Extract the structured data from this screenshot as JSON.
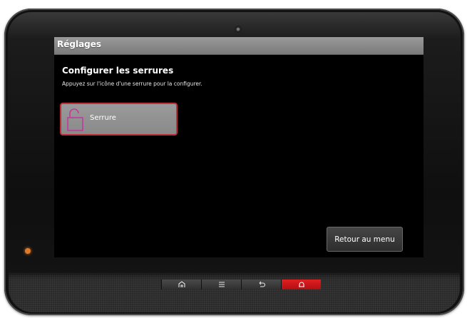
{
  "titlebar": {
    "title": "Réglages"
  },
  "main": {
    "heading": "Configurer les serrures",
    "subtitle": "Appuyez sur l'icône d'une serrure pour la configurer.",
    "locks": [
      {
        "label": "Serrure",
        "icon": "unlocked-padlock-icon"
      }
    ],
    "back_button": "Retour au menu"
  },
  "navbar": {
    "buttons": [
      {
        "name": "home",
        "icon": "home-icon"
      },
      {
        "name": "menu",
        "icon": "menu-icon"
      },
      {
        "name": "back",
        "icon": "back-arrow-icon"
      },
      {
        "name": "alarm",
        "icon": "alarm-icon",
        "color": "#d71920"
      }
    ]
  },
  "colors": {
    "titlebar": "#8a8a8a",
    "tile_border": "#c0303a",
    "lock_icon": "#c23a9c",
    "status_led": "#e07a2a"
  }
}
